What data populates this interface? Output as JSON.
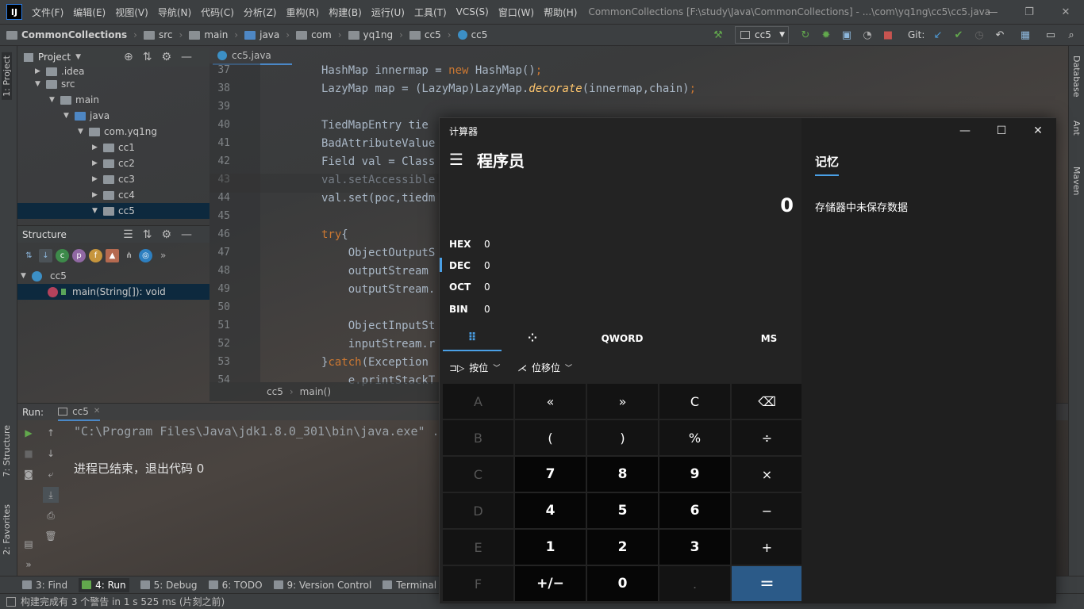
{
  "menubar": {
    "logo": "IJ",
    "items": [
      "文件(F)",
      "编辑(E)",
      "视图(V)",
      "导航(N)",
      "代码(C)",
      "分析(Z)",
      "重构(R)",
      "构建(B)",
      "运行(U)",
      "工具(T)",
      "VCS(S)",
      "窗口(W)",
      "帮助(H)"
    ],
    "title": "CommonCollections [F:\\study\\Java\\CommonCollections] - ...\\com\\yq1ng\\cc5\\cc5.java"
  },
  "navbar": {
    "crumbs": [
      "CommonCollections",
      "src",
      "main",
      "java",
      "com",
      "yq1ng",
      "cc5",
      "cc5"
    ],
    "run_config": "cc5",
    "git_label": "Git:"
  },
  "left_strip": {
    "project_tab": "1: Project",
    "structure_tab": "7: Structure",
    "favorites_tab": "2: Favorites"
  },
  "right_strip": {
    "database": "Database",
    "ant": "Ant",
    "maven": "Maven"
  },
  "project_panel": {
    "header": "Project",
    "tree": [
      ".idea",
      "src",
      "main",
      "java",
      "com.yq1ng",
      "cc1",
      "cc2",
      "cc3",
      "cc4",
      "cc5"
    ]
  },
  "structure_panel": {
    "header": "Structure",
    "class_name": "cc5",
    "method": "main(String[]): void"
  },
  "editor": {
    "tab": "cc5.java",
    "line_numbers": [
      "37",
      "38",
      "39",
      "40",
      "41",
      "42",
      "43",
      "44",
      "45",
      "46",
      "47",
      "48",
      "49",
      "50",
      "51",
      "52",
      "53",
      "54"
    ],
    "lines": [
      "HashMap innermap = new HashMap();",
      "LazyMap map = (LazyMap)LazyMap.decorate(innermap,chain);",
      "",
      "TiedMapEntry tie",
      "BadAttributeValue",
      "Field val = Class",
      "val.setAccessible",
      "val.set(poc,tiedm",
      "",
      "try{",
      "    ObjectOutputS",
      "    outputStream",
      "    outputStream.",
      "",
      "    ObjectInputSt",
      "    inputStream.r",
      "}catch(Exception",
      "    e.printStackT"
    ],
    "breadcrumb": [
      "cc5",
      "main()"
    ]
  },
  "run_panel": {
    "label": "Run:",
    "tab": "cc5",
    "command": "\"C:\\Program Files\\Java\\jdk1.8.0_301\\bin\\java.exe\" ...",
    "exit_message": "进程已结束，退出代码 0"
  },
  "bottom_tabs": [
    "3: Find",
    "4: Run",
    "5: Debug",
    "6: TODO",
    "9: Version Control",
    "Terminal"
  ],
  "status": "构建完成有 3 个警告 in 1 s 525 ms (片刻之前)",
  "calculator": {
    "window_title": "计算器",
    "mode": "程序员",
    "display": "0",
    "radix": [
      {
        "name": "HEX",
        "value": "0"
      },
      {
        "name": "DEC",
        "value": "0"
      },
      {
        "name": "OCT",
        "value": "0"
      },
      {
        "name": "BIN",
        "value": "0"
      }
    ],
    "word_size": "QWORD",
    "ms": "MS",
    "bitwise": "按位",
    "bitshift": "位移位",
    "memory_title": "记忆",
    "memory_empty": "存储器中未保存数据",
    "keys": [
      [
        "A",
        "«",
        "»",
        "C",
        "⌫"
      ],
      [
        "B",
        "(",
        ")",
        "%",
        "÷"
      ],
      [
        "C",
        "7",
        "8",
        "9",
        "×"
      ],
      [
        "D",
        "4",
        "5",
        "6",
        "−"
      ],
      [
        "E",
        "1",
        "2",
        "3",
        "+"
      ],
      [
        "F",
        "+/−",
        "0",
        ".",
        "="
      ]
    ]
  },
  "colors": {
    "accent": "#2b5a88",
    "keyword": "#cc7832",
    "method": "#ffc66d",
    "selection": "#0d293e"
  }
}
